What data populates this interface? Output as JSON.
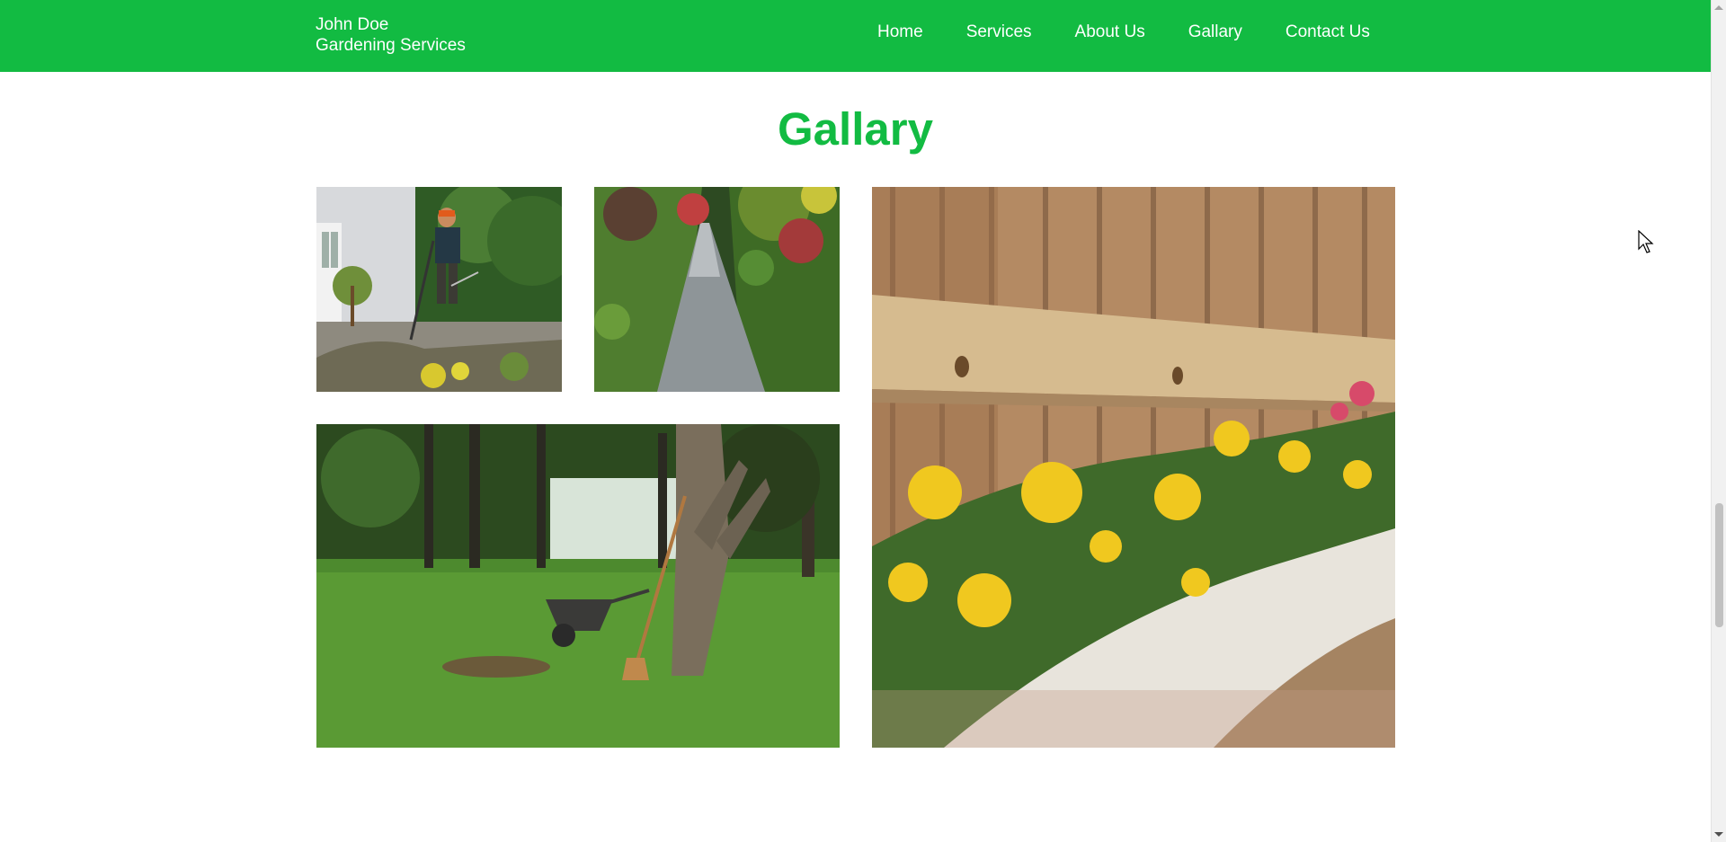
{
  "header": {
    "brand_line1": "John Doe",
    "brand_line2": "Gardening Services",
    "nav": [
      "Home",
      "Services",
      "About Us",
      "Gallary",
      "Contact Us"
    ],
    "background_color": "#12bb42"
  },
  "gallery": {
    "title": "Gallary",
    "title_color": "#12bb42",
    "images": [
      {
        "subject": "gardener trimming grass with string trimmer"
      },
      {
        "subject": "garden path between hedges"
      },
      {
        "subject": "wheelbarrow and rake under tree on lawn"
      },
      {
        "subject": "yellow marigolds by wooden fence"
      }
    ]
  },
  "icons": [
    "mouse-cursor-icon",
    "scroll-up-arrow-icon",
    "scroll-down-arrow-icon"
  ]
}
